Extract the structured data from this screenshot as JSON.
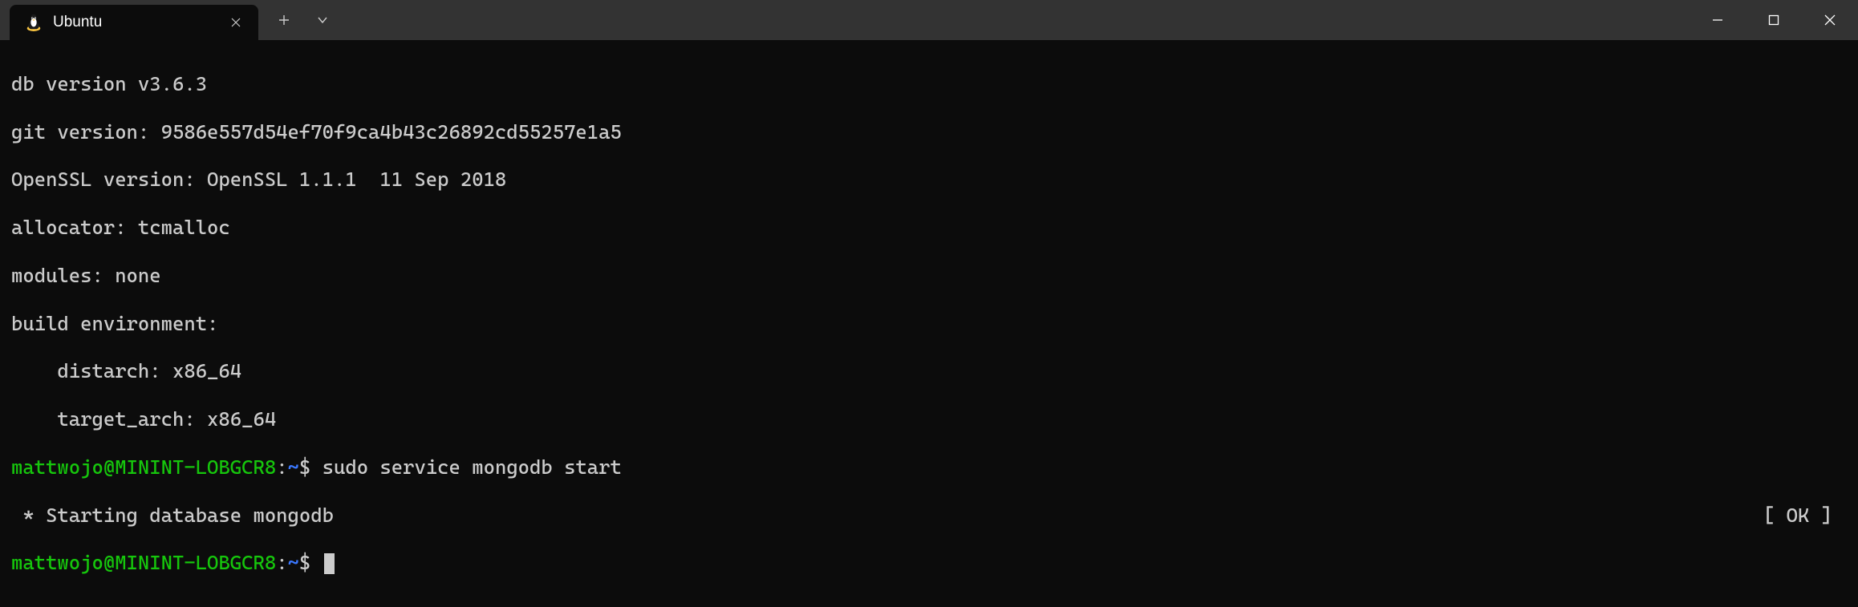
{
  "titlebar": {
    "tab": {
      "icon": "ubuntu-tux-icon",
      "title": "Ubuntu"
    }
  },
  "terminal": {
    "lines": {
      "l0": "db version v3.6.3",
      "l1": "git version: 9586e557d54ef70f9ca4b43c26892cd55257e1a5",
      "l2": "OpenSSL version: OpenSSL 1.1.1  11 Sep 2018",
      "l3": "allocator: tcmalloc",
      "l4": "modules: none",
      "l5": "build environment:",
      "l6": "    distarch: x86_64",
      "l7": "    target_arch: x86_64"
    },
    "prompt": {
      "user": "mattwojo",
      "at": "@",
      "host": "MININT-LOBGCR8",
      "colon": ":",
      "path": "~",
      "dollar": "$ "
    },
    "cmd1": "sudo service mongodb start",
    "status": {
      "left": " * Starting database mongodb",
      "right": "[ OK ]"
    }
  }
}
